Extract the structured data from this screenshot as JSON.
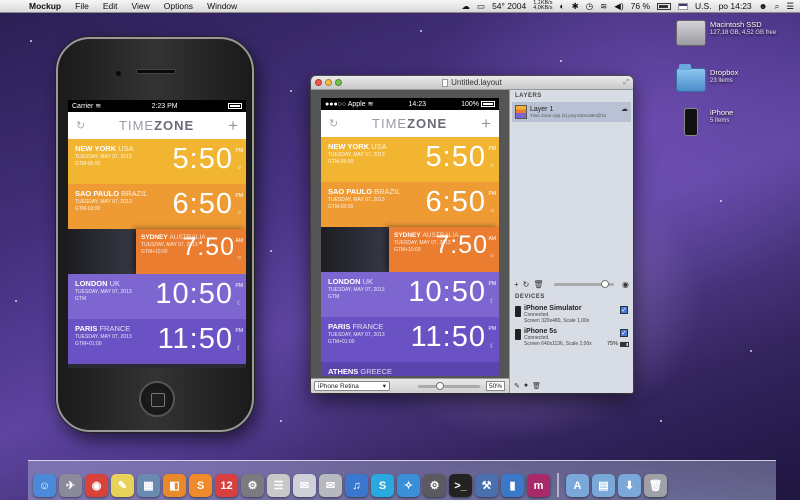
{
  "menubar": {
    "apple_glyph": "",
    "app_name": "Mockup",
    "menus": [
      "File",
      "Edit",
      "View",
      "Options",
      "Window"
    ],
    "temperature": "54° 2004",
    "net_up": "1,1KB/s",
    "net_down": "4,0KB/s",
    "battery": "76 %",
    "input_source": "U.S.",
    "clock": "po 14:23"
  },
  "desktop": {
    "icons": [
      {
        "name": "Macintosh SSD",
        "sub": "127,18 GB, 4,52 GB free"
      },
      {
        "name": "Dropbox",
        "sub": "23 items"
      },
      {
        "name": "iPhone",
        "sub": "5 items"
      }
    ]
  },
  "phone_left": {
    "carrier": "Carrier",
    "time": "2:23 PM"
  },
  "phone_canvas": {
    "carrier": "Apple",
    "time": "14:23",
    "battery": "100%"
  },
  "timezone_app": {
    "logo_a": "TIME",
    "logo_b": "ZONE",
    "refresh_glyph": "↻",
    "add_glyph": "+",
    "cities": [
      {
        "city": "NEW YORK",
        "country": "USA",
        "date": "TUESDAY, MAY 07, 2013",
        "gmt": "GTM-05:00",
        "time": "5:50",
        "ampm": "PM",
        "sym": "☼"
      },
      {
        "city": "SAO PAULO",
        "country": "BRAZIL",
        "date": "TUESDAY, MAY 07, 2013",
        "gmt": "GTM-03:00",
        "time": "6:50",
        "ampm": "PM",
        "sym": "☼"
      },
      {
        "city": "SYDNEY",
        "country": "AUSTRALIA",
        "date": "TUESDAY, MAY 07, 2013",
        "gmt": "GTM+10:00",
        "time": "7:50",
        "ampm": "AM",
        "sym": "☼"
      },
      {
        "city": "LONDON",
        "country": "UK",
        "date": "TUESDAY, MAY 07, 2013",
        "gmt": "GTM",
        "time": "10:50",
        "ampm": "PM",
        "sym": "☾"
      },
      {
        "city": "PARIS",
        "country": "FRANCE",
        "date": "TUESDAY, MAY 07, 2013",
        "gmt": "GTM+01:00",
        "time": "11:50",
        "ampm": "PM",
        "sym": "☾"
      },
      {
        "city": "ATHENS",
        "country": "GREECE",
        "date": "",
        "gmt": "",
        "time": "",
        "ampm": "",
        "sym": ""
      }
    ]
  },
  "window": {
    "title": "Untitled.layout",
    "device_select": "iPhone Retina",
    "zoom": "50%",
    "zoom_level": 0.35
  },
  "sidebar": {
    "layers_header": "LAYERS",
    "layer": {
      "name": "Layer 1",
      "file": "Time Zone App (2).png",
      "size": "640x1884@2x"
    },
    "devices_header": "DEVICES",
    "devices": [
      {
        "name": "iPhone Simulator",
        "status": "Connected.",
        "info": "Screen 320x480, Scale 1,00x",
        "checked": true,
        "battery": ""
      },
      {
        "name": "iPhone 5s",
        "status": "Connected.",
        "info": "Screen 640x1136, Scale 2,00x",
        "checked": true,
        "battery": "75%"
      }
    ],
    "opacity_level": 0.85
  },
  "dock": {
    "items": [
      {
        "name": "finder",
        "glyph": "☺",
        "color": "#4a8ad8"
      },
      {
        "name": "launchpad",
        "glyph": "✈",
        "color": "#8a8a9a"
      },
      {
        "name": "chrome",
        "glyph": "◉",
        "color": "#d8423a"
      },
      {
        "name": "stickies",
        "glyph": "✎",
        "color": "#e8d25a"
      },
      {
        "name": "preview",
        "glyph": "▦",
        "color": "#6a8ab0"
      },
      {
        "name": "ibooks",
        "glyph": "◧",
        "color": "#e88a2a"
      },
      {
        "name": "sublime",
        "glyph": "S",
        "color": "#f08a2a"
      },
      {
        "name": "calendar",
        "glyph": "12",
        "color": "#d84040"
      },
      {
        "name": "system-prefs-tool",
        "glyph": "⚙",
        "color": "#7a7a80"
      },
      {
        "name": "notes",
        "glyph": "☰",
        "color": "#c8c8c8"
      },
      {
        "name": "messages",
        "glyph": "✉",
        "color": "#d0d0d8"
      },
      {
        "name": "mail",
        "glyph": "✉",
        "color": "#b8b8c0"
      },
      {
        "name": "itunes",
        "glyph": "♫",
        "color": "#3a78d0"
      },
      {
        "name": "skype",
        "glyph": "S",
        "color": "#2aa8e0"
      },
      {
        "name": "safari",
        "glyph": "✧",
        "color": "#3a90d8"
      },
      {
        "name": "automator",
        "glyph": "⚙",
        "color": "#5a5a60"
      },
      {
        "name": "terminal",
        "glyph": ">_",
        "color": "#222"
      },
      {
        "name": "xcode",
        "glyph": "⚒",
        "color": "#4a70b0"
      },
      {
        "name": "mockup",
        "glyph": "▮",
        "color": "#3a78c8"
      },
      {
        "name": "mm-app",
        "glyph": "m",
        "color": "#a82a6a"
      },
      {
        "name": "applications-folder",
        "glyph": "A",
        "color": "#7aa8d8"
      },
      {
        "name": "documents-folder",
        "glyph": "▤",
        "color": "#7aa8d8"
      },
      {
        "name": "downloads-folder",
        "glyph": "⬇",
        "color": "#7aa8d8"
      },
      {
        "name": "trash",
        "glyph": "🗑",
        "color": "#a0a0a8"
      }
    ]
  }
}
